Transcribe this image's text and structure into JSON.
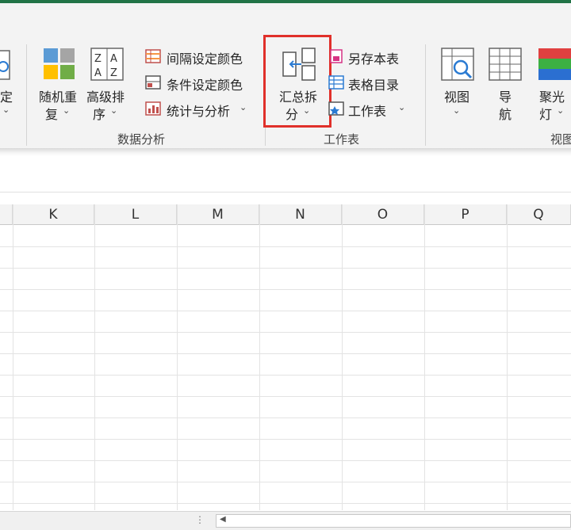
{
  "ribbon": {
    "partial_left": {
      "label": "定",
      "chevron": "⌄"
    },
    "groups": {
      "data_analysis": {
        "label": "数据分析",
        "random": {
          "line1": "随机重",
          "line2": "复"
        },
        "sort": {
          "line1": "高级排",
          "line2": "序"
        },
        "interval_color": "间隔设定颜色",
        "condition_color": "条件设定颜色",
        "stats": "统计与分析"
      },
      "worksheet": {
        "label": "工作表",
        "summary_split": {
          "line1": "汇总拆",
          "line2": "分"
        },
        "save_as": "另存本表",
        "table_catalog": "表格目录",
        "worksheet_menu": "工作表"
      },
      "view": {
        "label": "视图",
        "view_btn": "视图",
        "nav_btn": {
          "line1": "导",
          "line2": "航"
        },
        "spotlight": {
          "line1": "聚光",
          "line2": "灯"
        }
      }
    }
  },
  "columns": [
    "K",
    "L",
    "M",
    "N",
    "O",
    "P",
    "Q"
  ],
  "colors": {
    "accent": "#217346",
    "highlight_box": "#e0302a"
  }
}
